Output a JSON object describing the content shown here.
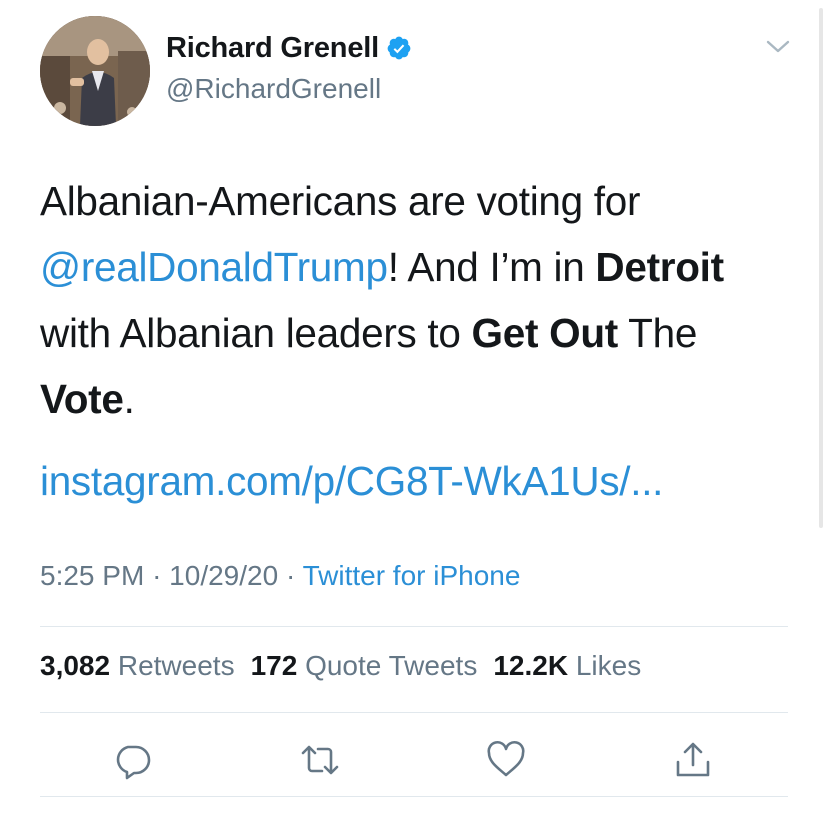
{
  "author": {
    "display_name": "Richard Grenell",
    "handle": "@RichardGrenell",
    "verified": true,
    "avatar_icon": "profile-photo"
  },
  "tweet": {
    "lines": [
      [
        {
          "t": "Albanian-Americans are voting for",
          "s": "text"
        }
      ],
      [
        {
          "t": "@realDonaldTrump",
          "s": "mention"
        },
        {
          "t": "! And I’m in ",
          "s": "text"
        },
        {
          "t": "Detroit",
          "s": "bold"
        }
      ],
      [
        {
          "t": "with Albanian leaders to ",
          "s": "text"
        },
        {
          "t": "Get Out",
          "s": "bold"
        },
        {
          "t": " The",
          "s": "text"
        }
      ],
      [
        {
          "t": "Vote",
          "s": "bold"
        },
        {
          "t": ".",
          "s": "text"
        }
      ]
    ],
    "link": "instagram.com/p/CG8T-WkA1Us/..."
  },
  "meta": {
    "time": "5:25 PM",
    "separator": "·",
    "date": "10/29/20",
    "source": "Twitter for iPhone"
  },
  "stats": {
    "retweets_count": "3,082",
    "retweets_label": "Retweets",
    "quotes_count": "172",
    "quotes_label": "Quote Tweets",
    "likes_count": "12.2K",
    "likes_label": "Likes"
  },
  "colors": {
    "link": "#2b8fd6",
    "secondary": "#657786",
    "verified": "#1da1f2",
    "divider": "#e1e8ed"
  },
  "icons": {
    "reply": "reply-icon",
    "retweet": "retweet-icon",
    "like": "like-icon",
    "share": "share-icon",
    "more": "chevron-down-icon",
    "verified": "verified-badge-icon"
  }
}
